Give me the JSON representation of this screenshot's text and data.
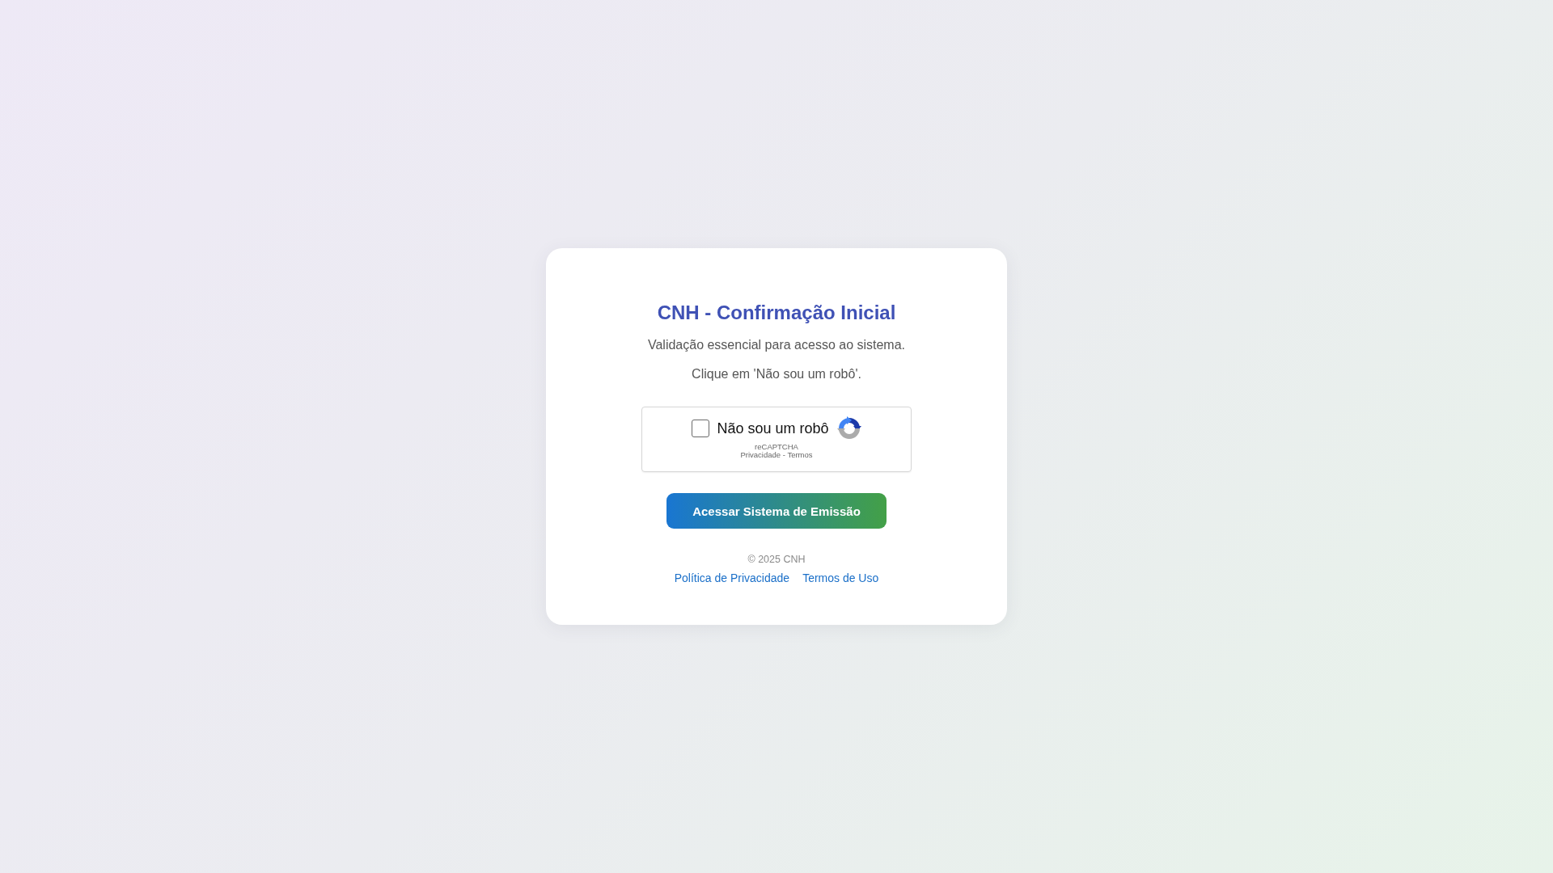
{
  "page": {
    "title": "CNH - Confirmação Inicial",
    "subtitle": "Validação essencial para acesso ao sistema.",
    "instruction": "Clique em 'Não sou um robô'."
  },
  "captcha": {
    "checked": false,
    "label": "Não sou um robô",
    "brand": "reCAPTCHA",
    "links": "Privacidade - Termos"
  },
  "button": {
    "label": "Acessar Sistema de Emissão"
  },
  "footer": {
    "copyright": "© 2025 CNH",
    "links": [
      "Política de Privacidade",
      "Termos de Uso"
    ]
  }
}
